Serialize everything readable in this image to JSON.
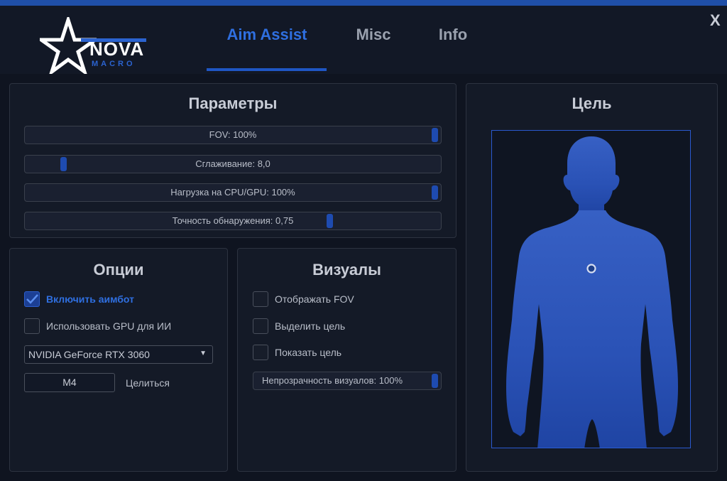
{
  "header": {
    "logo_main": "NOVA",
    "logo_sub": "MACRO",
    "tabs": [
      {
        "label": "Aim Assist",
        "active": true
      },
      {
        "label": "Misc",
        "active": false
      },
      {
        "label": "Info",
        "active": false
      }
    ],
    "close_label": "X"
  },
  "params": {
    "title": "Параметры",
    "sliders": [
      {
        "label": "FOV: 100%",
        "value_fraction": 1.0
      },
      {
        "label": "Сглаживание: 8,0",
        "value_fraction": 0.08
      },
      {
        "label": "Нагрузка на CPU/GPU: 100%",
        "value_fraction": 1.0
      },
      {
        "label": "Точность обнаружения: 0,75",
        "value_fraction": 0.74
      }
    ]
  },
  "options": {
    "title": "Опции",
    "checkboxes": [
      {
        "label": "Включить аимбот",
        "checked": true
      },
      {
        "label": "Использовать GPU для ИИ",
        "checked": false
      }
    ],
    "gpu_select": {
      "value": "NVIDIA GeForce RTX 3060"
    },
    "keybind": {
      "value": "M4",
      "label": "Целиться"
    }
  },
  "visuals": {
    "title": "Визуалы",
    "checkboxes": [
      {
        "label": "Отображать FOV",
        "checked": false
      },
      {
        "label": "Выделить цель",
        "checked": false
      },
      {
        "label": "Показать цель",
        "checked": false
      }
    ],
    "opacity_slider": {
      "label": "Непрозрачность визуалов: 100%",
      "value_fraction": 1.0
    }
  },
  "target": {
    "title": "Цель"
  },
  "colors": {
    "accent": "#2f6fe0",
    "background": "#0f1420",
    "panel": "#141a27",
    "silhouette": "#2a53b8"
  }
}
